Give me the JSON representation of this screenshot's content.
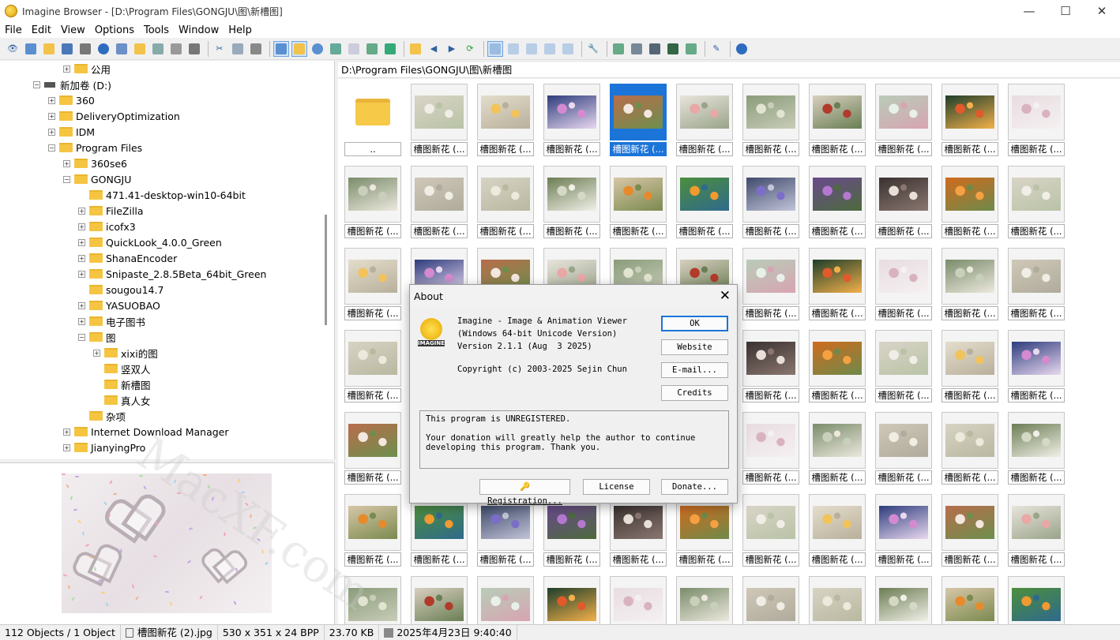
{
  "window": {
    "title": "Imagine Browser - [D:\\Program Files\\GONGJU\\图\\新槽图]",
    "min": "—",
    "max": "☐",
    "close": "✕"
  },
  "menu": [
    "File",
    "Edit",
    "View",
    "Options",
    "Tools",
    "Window",
    "Help"
  ],
  "tree": [
    {
      "label": "公用",
      "exp": "+"
    },
    {
      "label": "新加卷 (D:)",
      "exp": "-"
    },
    {
      "label": "360",
      "exp": "+"
    },
    {
      "label": "DeliveryOptimization",
      "exp": "+"
    },
    {
      "label": "IDM",
      "exp": "+"
    },
    {
      "label": "Program Files",
      "exp": "-"
    },
    {
      "label": "360se6",
      "exp": "+"
    },
    {
      "label": "GONGJU",
      "exp": "-"
    },
    {
      "label": "471.41-desktop-win10-64bit",
      "exp": ""
    },
    {
      "label": "FileZilla",
      "exp": "+"
    },
    {
      "label": "icofx3",
      "exp": "+"
    },
    {
      "label": "QuickLook_4.0.0_Green",
      "exp": "+"
    },
    {
      "label": "ShanaEncoder",
      "exp": "+"
    },
    {
      "label": "Snipaste_2.8.5Beta_64bit_Green",
      "exp": "+"
    },
    {
      "label": "sougou14.7",
      "exp": ""
    },
    {
      "label": "YASUOBAO",
      "exp": "+"
    },
    {
      "label": "电子图书",
      "exp": "+"
    },
    {
      "label": "图",
      "exp": "-"
    },
    {
      "label": "xixi的图",
      "exp": "+"
    },
    {
      "label": "竖双人",
      "exp": ""
    },
    {
      "label": "新槽图",
      "exp": ""
    },
    {
      "label": "真人女",
      "exp": ""
    },
    {
      "label": "杂项",
      "exp": ""
    },
    {
      "label": "Internet Download Manager",
      "exp": "+"
    },
    {
      "label": "JianyingPro",
      "exp": "+"
    }
  ],
  "path": "D:\\Program Files\\GONGJU\\图\\新槽图",
  "grid": {
    "folder_label": "..",
    "item_label": "槽图新花 (..."
  },
  "about": {
    "title": "About",
    "line1": "Imagine - Image & Animation Viewer",
    "line2": "(Windows 64-bit Unicode Version)",
    "line3": "Version 2.1.1 (Aug  3 2025)",
    "copyright": "Copyright (c) 2003-2025 Sejin Chun",
    "ok": "OK",
    "website": "Website",
    "email": "E-mail...",
    "credits": "Credits",
    "msg1": "This program is UNREGISTERED.",
    "msg2": "Your donation will greatly help the author to continue",
    "msg3": "developing this program. Thank you.",
    "registration": "Registration...",
    "license": "License",
    "donate": "Donate...",
    "logo_text": "IMAGINE"
  },
  "status": {
    "objects": "112 Objects / 1 Object",
    "file": "槽图新花 (2).jpg",
    "dims": "530 x 351 x 24 BPP",
    "size": "23.70 KB",
    "date": "2025年4月23日 9:40:40"
  },
  "watermark": "MacXF.com"
}
